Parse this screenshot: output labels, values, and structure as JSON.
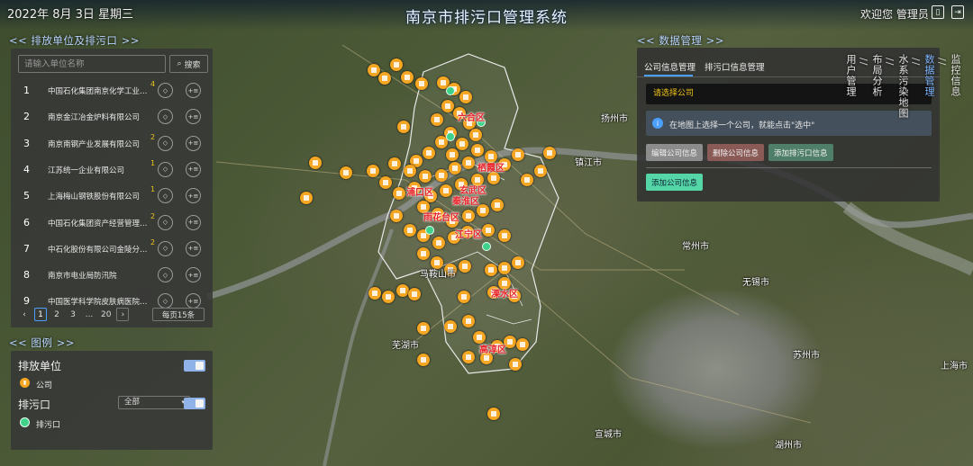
{
  "header": {
    "datetime": "2022年 8月 3日 星期三",
    "title": "南京市排污口管理系统",
    "welcome": "欢迎您 管理员"
  },
  "sections": {
    "left_list": "<< 排放单位及排污口 >>",
    "legend": "<< 图例 >>",
    "data_mgmt": "<< 数据管理 >>"
  },
  "search": {
    "placeholder": "请输入单位名称",
    "button": "搜索"
  },
  "companies": [
    {
      "num": "1",
      "name": "中国石化集团南京化学工业有限公司",
      "badge": "4"
    },
    {
      "num": "2",
      "name": "南京金江冶金炉料有限公司",
      "badge": ""
    },
    {
      "num": "3",
      "name": "南京南钢产业发展有限公司",
      "badge": "2"
    },
    {
      "num": "4",
      "name": "江苏统一企业有限公司",
      "badge": "1"
    },
    {
      "num": "5",
      "name": "上海梅山钢铁股份有限公司",
      "badge": "1"
    },
    {
      "num": "6",
      "name": "中国石化集团资产经营管理有限公司",
      "badge": "2"
    },
    {
      "num": "7",
      "name": "中石化股份有限公司金陵分公司",
      "badge": "2"
    },
    {
      "num": "8",
      "name": "南京市电业局防汛院",
      "badge": ""
    },
    {
      "num": "9",
      "name": "中国医学科学院皮肤病医院（研究所）",
      "badge": ""
    }
  ],
  "row_buttons": {
    "locate": "◇",
    "detail": "+≡"
  },
  "pagination": {
    "prev": "‹",
    "pages": [
      "1",
      "2",
      "3",
      "...",
      "20"
    ],
    "next": "›",
    "per_page": "每页15条"
  },
  "legend": {
    "discharge_unit": "排放单位",
    "company": "公司",
    "outfall": "排污口",
    "outfall_item": "排污口",
    "filter_value": "全部"
  },
  "data_panel": {
    "tabs": [
      "公司信息管理",
      "排污口信息管理"
    ],
    "select_placeholder": "请选择公司",
    "info": "在地图上选择一个公司，就能点击\"选中\"",
    "buttons": [
      "编辑公司信息",
      "删除公司信息",
      "添加排污口信息"
    ],
    "add_button": "添加公司信息"
  },
  "vertical_nav": [
    "监控信息",
    "数据管理",
    "水系污染地图",
    "布局分析",
    "用户管理"
  ],
  "map": {
    "districts": [
      "六合区",
      "栖霞区",
      "浦口区",
      "玄武区",
      "秦淮区",
      "雨花台区",
      "江宁区",
      "溧水区",
      "高淳区"
    ],
    "cities": [
      "扬州市",
      "镇江市",
      "马鞍山市",
      "芜湖市",
      "常州市",
      "无锡市",
      "苏州市",
      "上海市",
      "宣城市",
      "湖州市"
    ]
  },
  "colors": {
    "accent": "#4ba0ff",
    "company_marker": "#f5a623",
    "outfall_marker": "#3fd28a",
    "district_label": "#e8242a",
    "add_button": "#54d6a8"
  }
}
